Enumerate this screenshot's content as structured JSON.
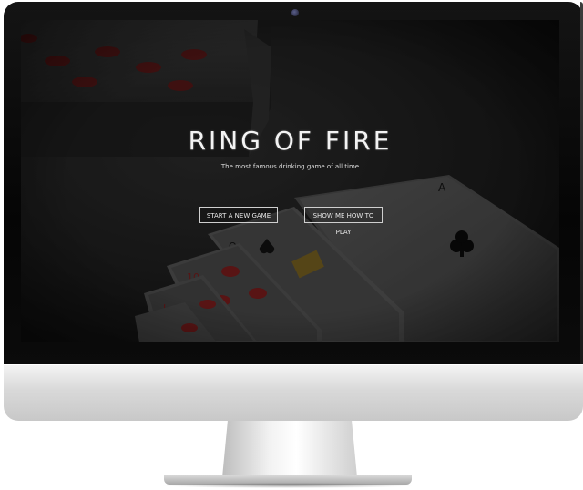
{
  "hero": {
    "title": "RING OF FIRE",
    "subtitle": "The most famous drinking game of all time",
    "start_button_label": "START A NEW GAME",
    "howto_button_label": "SHOW ME HOW TO PLAY"
  },
  "colors": {
    "screen_background": "#1c1c1c",
    "text": "#f3f3f3",
    "button_border": "#cfcfcf",
    "card_red": "#7a1c1c",
    "bezel": "#050505",
    "chin": "#d9d9d9"
  },
  "icons": {
    "camera": "webcam-dot",
    "card_suits": [
      "hearts",
      "clubs",
      "spades"
    ]
  }
}
